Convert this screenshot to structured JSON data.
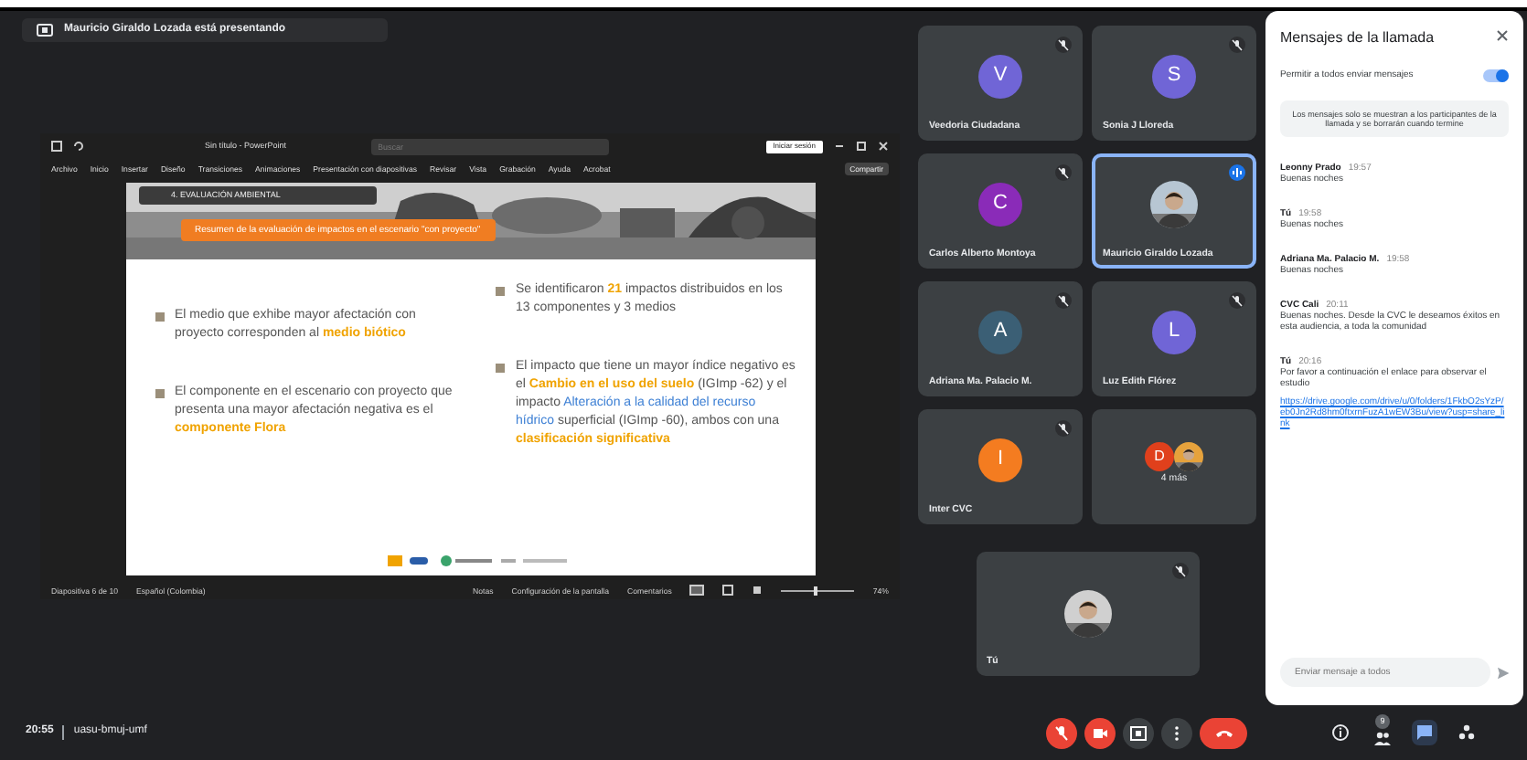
{
  "presenter_banner": {
    "text": "Mauricio Giraldo Lozada está presentando"
  },
  "shared_screen": {
    "app_title": "Sin título - PowerPoint",
    "search_placeholder": "Buscar",
    "account_button": "Iniciar sesión",
    "ribbon_tabs": [
      "Archivo",
      "Inicio",
      "Insertar",
      "Diseño",
      "Transiciones",
      "Animaciones",
      "Presentación con diapositivas",
      "Revisar",
      "Vista",
      "Grabación",
      "Ayuda",
      "Acrobat"
    ],
    "share_button": "Compartir",
    "slide": {
      "section_label": "4. EVALUACIÓN AMBIENTAL",
      "heading": "Resumen de la evaluación de impactos en el escenario \"con proyecto\"",
      "columns": [
        [
          "El medio que exhibe mayor afectación con proyecto corresponden al **medio biótico**",
          "El componente en el escenario con proyecto que presenta una mayor afectación negativa es el **componente Flora**"
        ],
        [
          "Se identificaron **21** impactos distribuidos en los 13 componentes y 3 medios",
          "El impacto que tiene un mayor índice negativo es el **Cambio en el uso del suelo** (IGImp -62) y el impacto *Alteración a la calidad del recurso hídrico* superficial (IGImp -60), ambos con una **clasificación significativa**"
        ]
      ]
    },
    "status_left": [
      "Diapositiva 6 de 10",
      "Español (Colombia)"
    ],
    "status_right": [
      "Notas",
      "Configuración de la pantalla",
      "Comentarios"
    ],
    "zoom_slider": {
      "level": 0.45
    },
    "zoom_text": "74%"
  },
  "tiles": [
    {
      "name": "Veedoria Ciudadana",
      "kind": "initial",
      "initial": "V",
      "color": "#7065d6",
      "muted": true,
      "speaking": false
    },
    {
      "name": "Sonia J Lloreda",
      "kind": "initial",
      "initial": "S",
      "color": "#7065d6",
      "muted": true,
      "speaking": false
    },
    {
      "name": "Carlos Alberto Montoya",
      "kind": "initial",
      "initial": "C",
      "color": "#8a2bb8",
      "muted": true,
      "speaking": false
    },
    {
      "name": "Mauricio Giraldo Lozada",
      "muted": false,
      "speaking": true
    },
    {
      "name": "Adriana Ma. Palacio M.",
      "kind": "initial",
      "initial": "A",
      "color": "#3b5f75",
      "muted": true,
      "speaking": false
    },
    {
      "name": "Luz Edith Flórez",
      "kind": "initial",
      "initial": "L",
      "color": "#7065d6",
      "muted": true,
      "speaking": false
    },
    {
      "name": "Inter CVC",
      "kind": "initial",
      "initial": "I",
      "color": "#f47c20",
      "muted": true,
      "speaking": false
    },
    {
      "name": "4 más",
      "kind": "group",
      "initial": "D",
      "color": "#e0401c",
      "muted": false,
      "speaking": false
    },
    {
      "name": "Tú",
      "muted": true,
      "speaking": false
    }
  ],
  "chat": {
    "title": "Mensajes de la llamada",
    "allow_label": "Permitir a todos enviar mensajes",
    "allow_toggle": {
      "on": true
    },
    "notice": "Los mensajes solo se muestran a los participantes de la llamada y se borrarán cuando termine",
    "messages": [
      {
        "sender": "Leonny Prado",
        "time": "19:57",
        "text": "Buenas noches"
      },
      {
        "sender": "Tú",
        "time": "19:58",
        "text": "Buenas noches"
      },
      {
        "sender": "Adriana Ma. Palacio M.",
        "time": "19:58",
        "text": "Buenas noches"
      },
      {
        "sender": "CVC Cali",
        "time": "20:11",
        "text": "Buenas noches. Desde la CVC le deseamos éxitos en esta audiencia, a toda la comunidad"
      },
      {
        "sender": "Tú",
        "time": "20:16",
        "text": "Por favor a continuación el enlace para observar el estudio",
        "link": "https://drive.google.com/drive/u/0/folders/1FkbO2sYzP/eb0Jn2Rd8hm0ftxrnFuzA1wEW3Bu/view?usp=share_link"
      }
    ],
    "input_placeholder": "Enviar mensaje a todos"
  },
  "bottom_bar": {
    "time": "20:55",
    "meeting_code": "uasu-bmuj-umf",
    "controls": [
      {
        "kind": "mic",
        "on": false
      },
      {
        "kind": "camera",
        "on": false
      },
      {
        "kind": "present"
      },
      {
        "kind": "more"
      },
      {
        "kind": "hangup"
      }
    ],
    "side_buttons": [
      {
        "kind": "info",
        "selected": false
      },
      {
        "kind": "people",
        "selected": false,
        "badge": "9"
      },
      {
        "kind": "chat",
        "selected": true
      },
      {
        "kind": "activities",
        "selected": false
      }
    ]
  }
}
